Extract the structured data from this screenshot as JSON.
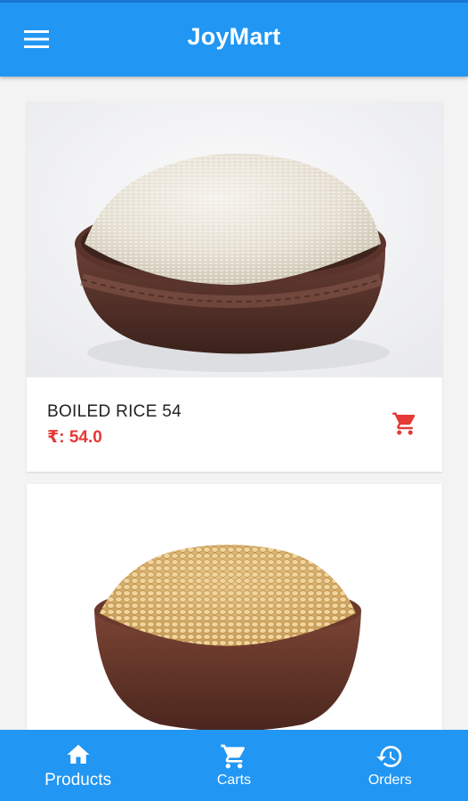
{
  "app": {
    "title": "JoyMart",
    "accent_color": "#2196f3",
    "price_color": "#e53935"
  },
  "appbar": {
    "menu_icon": "hamburger-menu-icon"
  },
  "products": [
    {
      "name": "BOILED RICE 54",
      "price": "₹: 54.0",
      "image": "rice-bowl",
      "cart_icon": "add-to-cart-icon"
    },
    {
      "name": "",
      "price": "",
      "image": "lentil-bowl",
      "cart_icon": "add-to-cart-icon"
    }
  ],
  "bottom_nav": {
    "items": [
      {
        "label": "Products",
        "icon": "home-icon",
        "active": true
      },
      {
        "label": "Carts",
        "icon": "cart-icon",
        "active": false
      },
      {
        "label": "Orders",
        "icon": "history-icon",
        "active": false
      }
    ]
  }
}
